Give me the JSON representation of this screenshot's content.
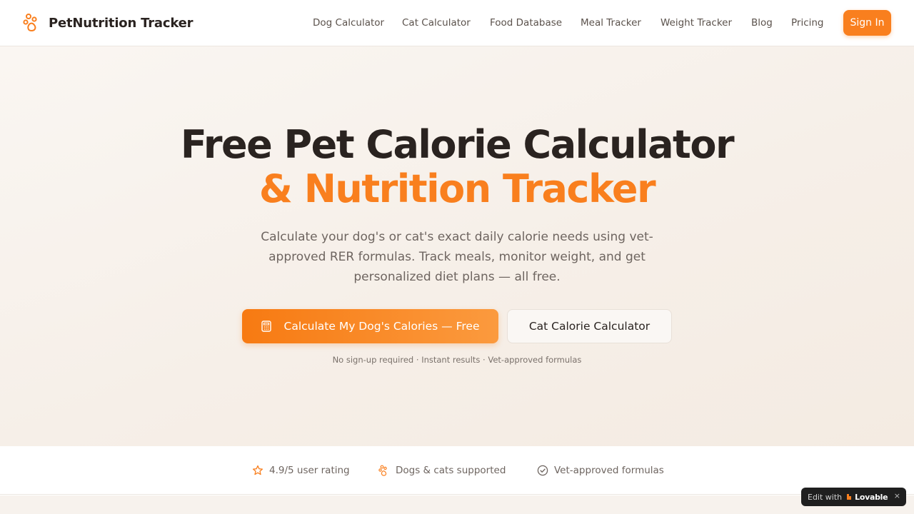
{
  "header": {
    "brand": "PetNutrition Tracker",
    "nav": [
      {
        "label": "Dog Calculator"
      },
      {
        "label": "Cat Calculator"
      },
      {
        "label": "Food Database"
      },
      {
        "label": "Meal Tracker"
      },
      {
        "label": "Weight Tracker"
      },
      {
        "label": "Blog"
      },
      {
        "label": "Pricing"
      }
    ],
    "signin_label": "Sign In"
  },
  "hero": {
    "title_line1": "Free Pet Calorie Calculator",
    "title_line2": "& Nutrition Tracker",
    "subtitle": "Calculate your dog's or cat's exact daily calorie needs using vet-approved RER formulas. Track meals, monitor weight, and get personalized diet plans — all free.",
    "primary_cta": "Calculate My Dog's Calories — Free",
    "secondary_cta": "Cat Calorie Calculator",
    "note": "No sign-up required · Instant results · Vet-approved formulas"
  },
  "stats": [
    {
      "icon": "star-icon",
      "label": "4.9/5 user rating"
    },
    {
      "icon": "paw-icon",
      "label": "Dogs & cats supported"
    },
    {
      "icon": "check-circle-icon",
      "label": "Vet-approved formulas"
    }
  ],
  "badge": {
    "edit_label": "Edit with",
    "brand": "Lovable",
    "close": "×"
  },
  "colors": {
    "accent": "#f97f1e",
    "text": "#2a2320",
    "muted": "#6e6560",
    "hero_bg": "#f6efe8"
  }
}
